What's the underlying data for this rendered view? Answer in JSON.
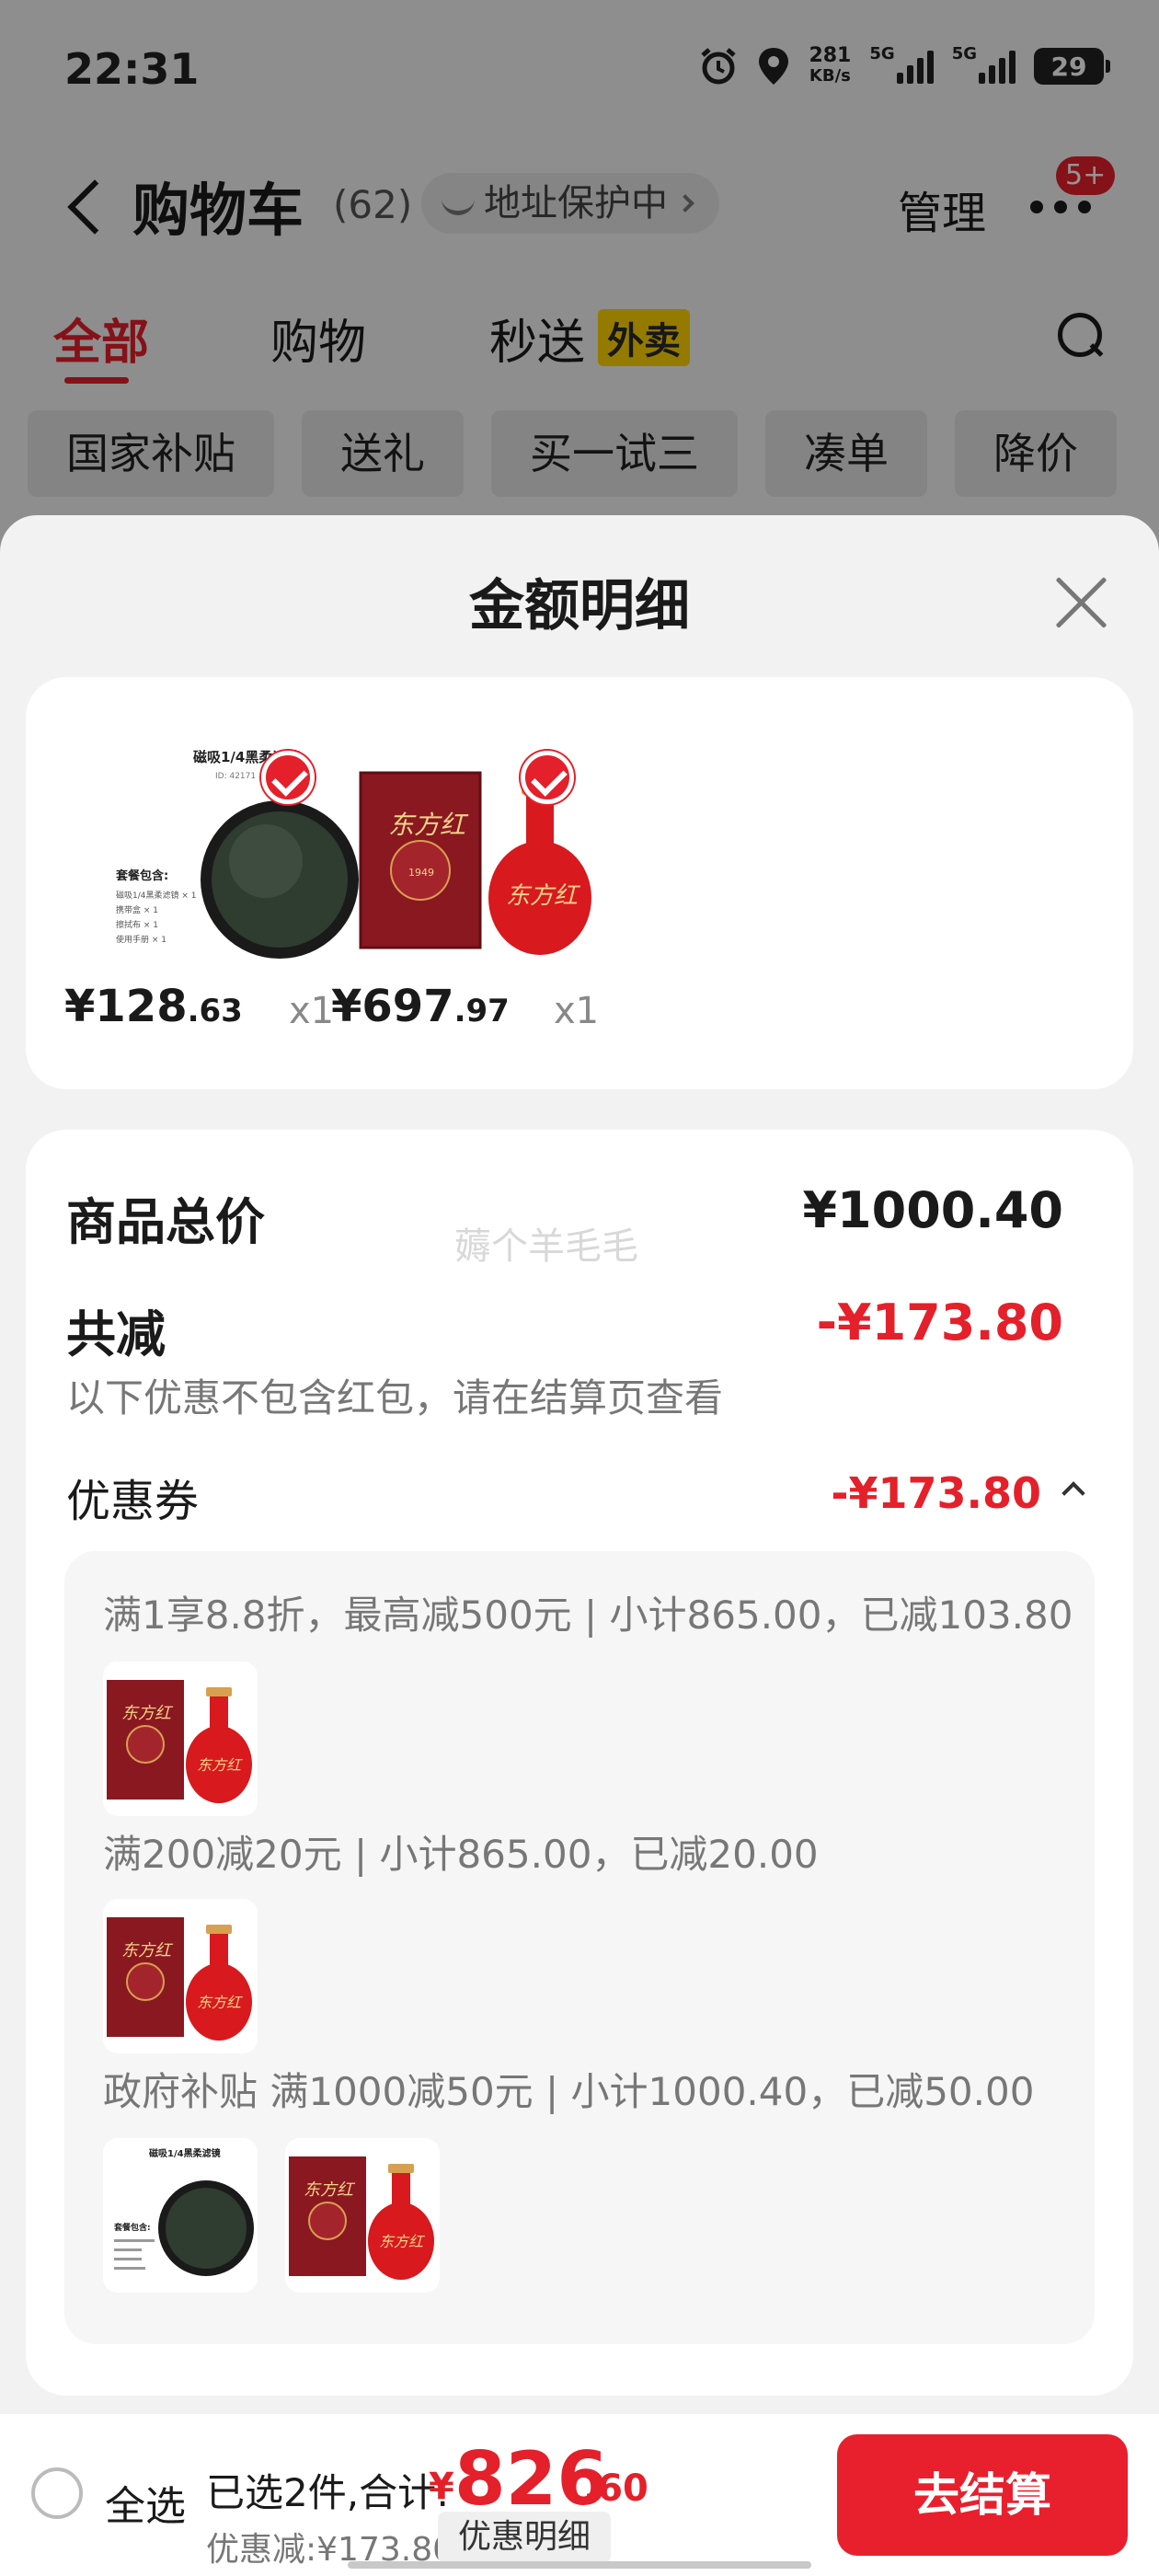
{
  "status": {
    "time": "22:31",
    "speed_value": "281",
    "speed_unit": "KB/s",
    "sig1": "5G",
    "sig2": "5G",
    "battery": "29"
  },
  "header": {
    "title": "购物车",
    "count": "(62)",
    "address_pill": "地址保护中",
    "manage": "管理",
    "badge": "5+"
  },
  "tabs": {
    "all": "全部",
    "shopping": "购物",
    "express": "秒送",
    "takeout_tag": "外卖"
  },
  "chips": [
    "国家补贴",
    "送礼",
    "买一试三",
    "凑单",
    "降价"
  ],
  "sheet": {
    "title": "金额明细",
    "products": [
      {
        "price_int": "¥128",
        "price_dec": ".63",
        "qty": "x1",
        "name": "磁吸1/4黑柔滤镜",
        "item_id": "ID: 42171",
        "package_title": "套餐包含:",
        "package_items": [
          "磁吸1/4黑柔滤镜 × 1",
          "携带盒 × 1",
          "擦拭布 × 1",
          "使用手册 × 1"
        ]
      },
      {
        "price_int": "¥697",
        "price_dec": ".97",
        "qty": "x1",
        "name": "东方红",
        "year": "1949"
      }
    ],
    "total_label": "商品总价",
    "total_value": "¥1000.40",
    "watermark": "薅个羊毛毛",
    "reduce_label": "共减",
    "reduce_value": "-¥173.80",
    "note": "以下优惠不包含红包，请在结算页查看",
    "coupon_label": "优惠券",
    "coupon_value": "-¥173.80",
    "coupon_lines": [
      "满1享8.8折，最高减500元 | 小计865.00，已减103.80",
      "满200减20元 | 小计865.00，已减20.00",
      "政府补贴 满1000减50元 | 小计1000.40，已减50.00"
    ]
  },
  "bottom": {
    "select_all": "全选",
    "selected": "已选2件,合计:",
    "yen": "¥",
    "total_int": "826",
    "total_dec": ".60",
    "saved": "优惠减:¥173.80",
    "detail_btn": "优惠明细",
    "checkout": "去结算"
  },
  "colors": {
    "accent": "#e4202a",
    "takeout_tag": "#ffd400"
  }
}
